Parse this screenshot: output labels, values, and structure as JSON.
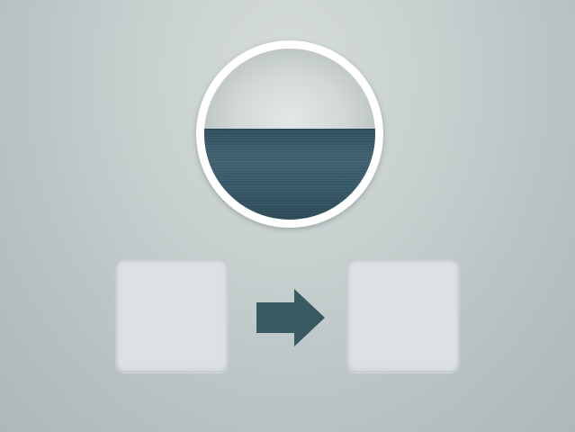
{
  "avatar": {
    "icon": "ocean-horizon-photo",
    "frame_color": "#ffffff",
    "sky_color": "#dadfdf",
    "sea_color": "#355766"
  },
  "slots": [
    {
      "name": "source-slot",
      "fill_color": "#dde1e3"
    },
    {
      "name": "target-slot",
      "fill_color": "#dde1e3"
    }
  ],
  "arrow": {
    "icon": "arrow-right-icon",
    "color": "#3a5a63"
  },
  "theme": {
    "background_color": "#c3cccc"
  }
}
